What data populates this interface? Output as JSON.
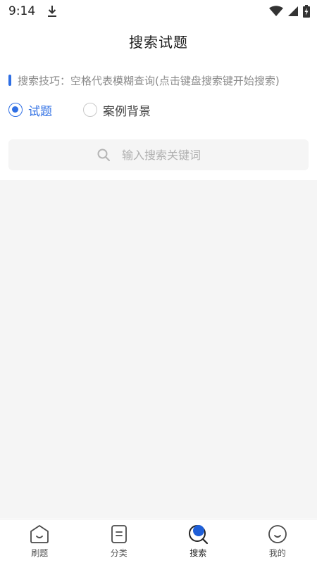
{
  "status_bar": {
    "time": "9:14"
  },
  "header": {
    "title": "搜索试题"
  },
  "tip": {
    "text": "搜索技巧：空格代表模糊查询(点击键盘搜索键开始搜索)"
  },
  "search_type": {
    "options": [
      {
        "label": "试题",
        "selected": true
      },
      {
        "label": "案例背景",
        "selected": false
      }
    ]
  },
  "search": {
    "placeholder": "输入搜索关键词",
    "value": ""
  },
  "tab_bar": {
    "items": [
      {
        "label": "刷题",
        "icon": "house-face-icon",
        "active": false
      },
      {
        "label": "分类",
        "icon": "document-list-icon",
        "active": false
      },
      {
        "label": "搜索",
        "icon": "search-icon",
        "active": true
      },
      {
        "label": "我的",
        "icon": "smiley-face-icon",
        "active": false
      }
    ]
  },
  "colors": {
    "accent": "#2f6fe4",
    "tip_text": "#8a8a8a",
    "placeholder": "#b0b0b0",
    "panel_bg": "#f5f5f5"
  }
}
